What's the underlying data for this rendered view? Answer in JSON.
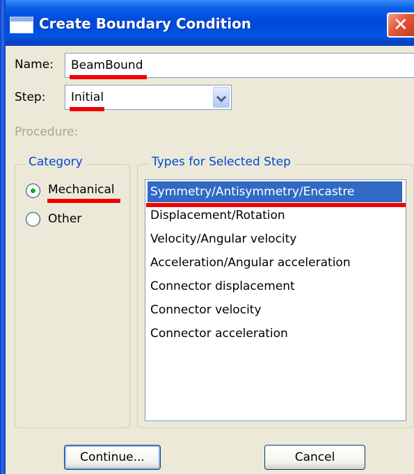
{
  "window": {
    "title": "Create Boundary Condition",
    "close_glyph": "✕"
  },
  "form": {
    "name_label": "Name:",
    "name_value": "BeamBound",
    "step_label": "Step:",
    "step_value": "Initial",
    "procedure_label": "Procedure:"
  },
  "category": {
    "legend": "Category",
    "options": [
      {
        "label": "Mechanical",
        "selected": true
      },
      {
        "label": "Other",
        "selected": false
      }
    ]
  },
  "types": {
    "legend": "Types for Selected Step",
    "items": [
      "Symmetry/Antisymmetry/Encastre",
      "Displacement/Rotation",
      "Velocity/Angular velocity",
      "Acceleration/Angular acceleration",
      "Connector displacement",
      "Connector velocity",
      "Connector acceleration"
    ],
    "selected_index": 0
  },
  "buttons": {
    "continue_label": "Continue...",
    "cancel_label": "Cancel"
  },
  "colors": {
    "titlebar": "#0055e5",
    "selection": "#316ac5",
    "annotation": "#f00000",
    "legend": "#0046d5"
  }
}
